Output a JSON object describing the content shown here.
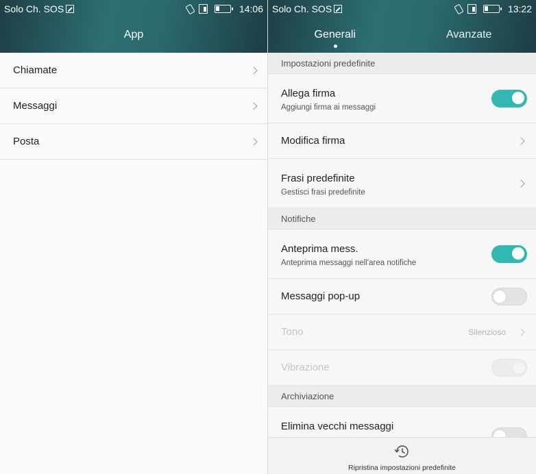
{
  "left_screen": {
    "status": {
      "carrier": "Solo Ch. SOS",
      "time": "14:06"
    },
    "title": "App",
    "items": [
      {
        "label": "Chiamate"
      },
      {
        "label": "Messaggi"
      },
      {
        "label": "Posta"
      }
    ]
  },
  "right_screen": {
    "status": {
      "carrier": "Solo Ch. SOS",
      "time": "13:22"
    },
    "tabs": [
      {
        "label": "Generali",
        "active": true
      },
      {
        "label": "Avanzate",
        "active": false
      }
    ],
    "sections": {
      "defaults": "Impostazioni predefinite",
      "notifications": "Notifiche",
      "archive": "Archiviazione"
    },
    "settings": {
      "signature": {
        "title": "Allega firma",
        "subtitle": "Aggiungi firma ai messaggi",
        "on": true
      },
      "edit_signature": {
        "title": "Modifica firma"
      },
      "phrases": {
        "title": "Frasi predefinite",
        "subtitle": "Gestisci frasi predefinite"
      },
      "preview": {
        "title": "Anteprima mess.",
        "subtitle": "Anteprima messaggi nell'area notifiche",
        "on": true
      },
      "popup": {
        "title": "Messaggi pop-up",
        "on": false
      },
      "tone": {
        "title": "Tono",
        "value": "Silenzioso",
        "enabled": false
      },
      "vibration": {
        "title": "Vibrazione",
        "enabled": false
      },
      "delete_old": {
        "title": "Elimina vecchi messaggi",
        "on": false
      }
    },
    "bottom_action": {
      "label": "Ripristina impostazioni predefinite"
    }
  },
  "colors": {
    "accent": "#32b8b2",
    "header": "#2c6f72"
  }
}
